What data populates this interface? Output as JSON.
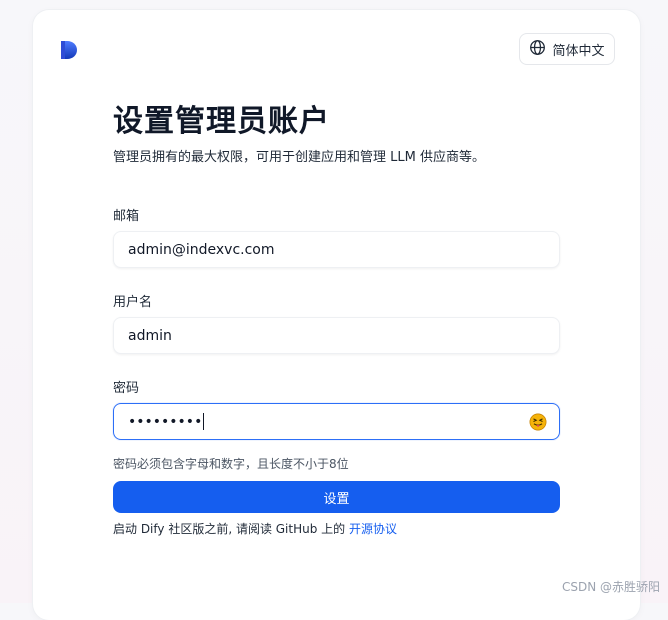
{
  "header": {
    "language_label": "简体中文",
    "language_icon": "globe-icon",
    "logo_icon": "dify-logo-icon"
  },
  "main": {
    "title": "设置管理员账户",
    "subtitle": "管理员拥有的最大权限，可用于创建应用和管理 LLM 供应商等。"
  },
  "form": {
    "email": {
      "label": "邮箱",
      "value": "admin@indexvc.com"
    },
    "username": {
      "label": "用户名",
      "value": "admin"
    },
    "password": {
      "label": "密码",
      "masked_value": "•••••••••",
      "toggle_icon": "tongue-face-icon",
      "hint": "密码必须包含字母和数字，且长度不小于8位"
    },
    "submit_label": "设置"
  },
  "footer": {
    "terms_prefix": "启动 Dify 社区版之前, 请阅读 GitHub 上的 ",
    "terms_link": "开源协议"
  },
  "watermark": "CSDN @赤胜骄阳",
  "colors": {
    "primary": "#155eef",
    "focus_border": "#2d6ff7",
    "emoji_face": "#f5b30a"
  }
}
